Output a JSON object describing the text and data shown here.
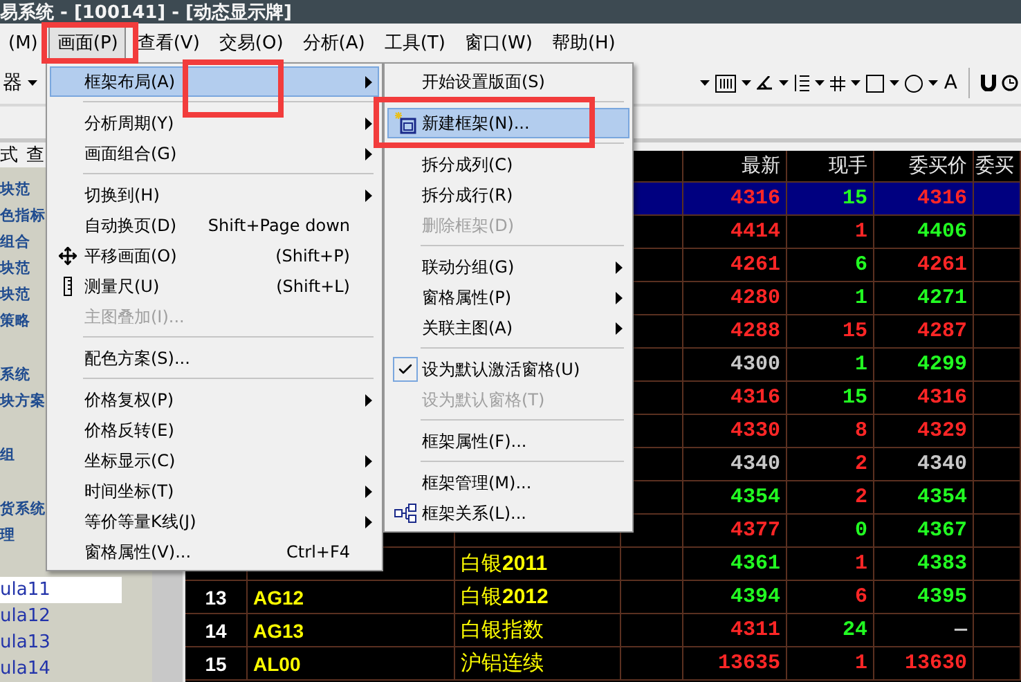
{
  "title_bar": {
    "title": "易系统 - [100141] - [动态显示牌]"
  },
  "menu_bar": [
    {
      "label": "(M)",
      "selected": false
    },
    {
      "label": "画面(P)",
      "selected": true
    },
    {
      "label": "查看(V)",
      "selected": false
    },
    {
      "label": "交易(O)",
      "selected": false
    },
    {
      "label": "分析(A)",
      "selected": false
    },
    {
      "label": "工具(T)",
      "selected": false
    },
    {
      "label": "窗口(W)",
      "selected": false
    },
    {
      "label": "帮助(H)",
      "selected": false
    }
  ],
  "toolbar": {
    "left_label": "器",
    "tools": [
      {
        "kind": "caret"
      },
      {
        "kind": "columns"
      },
      {
        "kind": "caret"
      },
      {
        "kind": "angle"
      },
      {
        "kind": "caret"
      },
      {
        "kind": "list"
      },
      {
        "kind": "caret"
      },
      {
        "kind": "grid"
      },
      {
        "kind": "caret"
      },
      {
        "kind": "square"
      },
      {
        "kind": "caret"
      },
      {
        "kind": "circle"
      },
      {
        "kind": "caret"
      },
      {
        "kind": "text",
        "label": "A"
      },
      {
        "kind": "separator"
      },
      {
        "kind": "magnet"
      },
      {
        "kind": "clock"
      }
    ]
  },
  "sidebar": {
    "tabs": [
      "式",
      "查"
    ],
    "groups": [
      {
        "kind": "category",
        "items": [
          {
            "label": "块范",
            "selected": false
          },
          {
            "label": "色指标",
            "selected": false
          },
          {
            "label": "组合",
            "selected": false
          },
          {
            "label": "块范",
            "selected": false
          },
          {
            "label": "块范",
            "selected": false
          },
          {
            "label": "策略",
            "selected": false
          }
        ]
      },
      {
        "kind": "category",
        "items": [
          {
            "label": "系统",
            "selected": false
          },
          {
            "label": "块方案",
            "selected": false
          }
        ]
      },
      {
        "kind": "category",
        "items": [
          {
            "label": "组",
            "selected": false
          }
        ]
      },
      {
        "kind": "category",
        "items": [
          {
            "label": "货系统",
            "selected": false
          },
          {
            "label": "理",
            "selected": false
          }
        ]
      },
      {
        "kind": "formula",
        "items": [
          {
            "label": "ula11",
            "selected": true
          },
          {
            "label": "ula12",
            "selected": false
          },
          {
            "label": "ula13",
            "selected": false
          },
          {
            "label": "ula14",
            "selected": false
          }
        ]
      }
    ]
  },
  "table": {
    "columns": [
      {
        "label": "最新"
      },
      {
        "label": "现手"
      },
      {
        "label": "委买价"
      },
      {
        "label": "委买"
      }
    ],
    "rows": [
      {
        "selected": true,
        "last": {
          "text": "4316",
          "color": "#ff2626"
        },
        "volume": {
          "text": "15",
          "color": "#22ff22"
        },
        "bid": {
          "text": "4316",
          "color": "#ff2626"
        }
      },
      {
        "selected": false,
        "last": {
          "text": "4414",
          "color": "#ff2626"
        },
        "volume": {
          "text": "1",
          "color": "#ff2626"
        },
        "bid": {
          "text": "4406",
          "color": "#22ff22"
        }
      },
      {
        "selected": false,
        "last": {
          "text": "4261",
          "color": "#ff2626"
        },
        "volume": {
          "text": "6",
          "color": "#22ff22"
        },
        "bid": {
          "text": "4261",
          "color": "#ff2626"
        }
      },
      {
        "selected": false,
        "last": {
          "text": "4280",
          "color": "#ff2626"
        },
        "volume": {
          "text": "1",
          "color": "#22ff22"
        },
        "bid": {
          "text": "4271",
          "color": "#22ff22"
        }
      },
      {
        "selected": false,
        "last": {
          "text": "4288",
          "color": "#ff2626"
        },
        "volume": {
          "text": "15",
          "color": "#ff2626"
        },
        "bid": {
          "text": "4287",
          "color": "#ff2626"
        }
      },
      {
        "selected": false,
        "last": {
          "text": "4300",
          "color": "#c8c8c8"
        },
        "volume": {
          "text": "1",
          "color": "#22ff22"
        },
        "bid": {
          "text": "4299",
          "color": "#22ff22"
        }
      },
      {
        "selected": false,
        "last": {
          "text": "4316",
          "color": "#ff2626"
        },
        "volume": {
          "text": "15",
          "color": "#22ff22"
        },
        "bid": {
          "text": "4316",
          "color": "#ff2626"
        }
      },
      {
        "selected": false,
        "last": {
          "text": "4330",
          "color": "#ff2626"
        },
        "volume": {
          "text": "8",
          "color": "#ff2626"
        },
        "bid": {
          "text": "4329",
          "color": "#ff2626"
        }
      },
      {
        "selected": false,
        "last": {
          "text": "4340",
          "color": "#c8c8c8"
        },
        "volume": {
          "text": "2",
          "color": "#ff2626"
        },
        "bid": {
          "text": "4340",
          "color": "#c8c8c8"
        }
      },
      {
        "selected": false,
        "last": {
          "text": "4354",
          "color": "#22ff22"
        },
        "volume": {
          "text": "2",
          "color": "#ff2626"
        },
        "bid": {
          "text": "4354",
          "color": "#22ff22"
        }
      },
      {
        "selected": false,
        "last": {
          "text": "4377",
          "color": "#ff2626"
        },
        "volume": {
          "text": "0",
          "color": "#22ff22"
        },
        "bid": {
          "text": "4367",
          "color": "#22ff22"
        }
      },
      {
        "selected": false,
        "name": "白银**2011**",
        "last": {
          "text": "4361",
          "color": "#22ff22"
        },
        "volume": {
          "text": "1",
          "color": "#ff2626"
        },
        "bid": {
          "text": "4383",
          "color": "#22ff22"
        }
      },
      {
        "selected": false,
        "number": "13",
        "code": "AG12",
        "name": "白银**2012**",
        "last": {
          "text": "4394",
          "color": "#22ff22"
        },
        "volume": {
          "text": "6",
          "color": "#ff2626"
        },
        "bid": {
          "text": "4395",
          "color": "#22ff22"
        }
      },
      {
        "selected": false,
        "number": "14",
        "code": "AG13",
        "name": "白银指数",
        "last": {
          "text": "4311",
          "color": "#ff2626"
        },
        "volume": {
          "text": "24",
          "color": "#22ff22"
        },
        "bid": {
          "text": "—",
          "color": "#c8c8c8"
        }
      },
      {
        "selected": false,
        "number": "15",
        "code": "AL00",
        "name": "沪铝连续",
        "last": {
          "text": "13635",
          "color": "#ff2626"
        },
        "volume": {
          "text": "1",
          "color": "#ff2626"
        },
        "bid": {
          "text": "13630",
          "color": "#ff2626"
        }
      }
    ]
  },
  "view_menu": {
    "items": [
      {
        "kind": "item",
        "label": "框架布局(A)",
        "selected": true,
        "disabled": false,
        "submenu": true
      },
      {
        "kind": "separator"
      },
      {
        "kind": "item",
        "label": "分析周期(Y)",
        "selected": false,
        "disabled": false,
        "submenu": true
      },
      {
        "kind": "item",
        "label": "画面组合(G)",
        "selected": false,
        "disabled": false,
        "submenu": true
      },
      {
        "kind": "separator"
      },
      {
        "kind": "item",
        "label": "切换到(H)",
        "selected": false,
        "disabled": false,
        "submenu": true
      },
      {
        "kind": "item",
        "label": "自动换页(D)",
        "shortcut": "Shift+Page down",
        "selected": false,
        "disabled": false,
        "submenu": false
      },
      {
        "kind": "item",
        "label": "平移画面(O)",
        "shortcut": "(Shift+P)",
        "selected": false,
        "disabled": false,
        "submenu": false
      },
      {
        "kind": "item",
        "label": "测量尺(U)",
        "shortcut": "(Shift+L)",
        "selected": false,
        "disabled": false,
        "submenu": false
      },
      {
        "kind": "item",
        "label": "主图叠加(I)...",
        "selected": false,
        "disabled": true,
        "submenu": false
      },
      {
        "kind": "separator"
      },
      {
        "kind": "item",
        "label": "配色方案(S)...",
        "selected": false,
        "disabled": false,
        "submenu": false
      },
      {
        "kind": "separator"
      },
      {
        "kind": "item",
        "label": "价格复权(P)",
        "selected": false,
        "disabled": false,
        "submenu": true
      },
      {
        "kind": "item",
        "label": "价格反转(E)",
        "selected": false,
        "disabled": false,
        "submenu": false
      },
      {
        "kind": "item",
        "label": "坐标显示(C)",
        "selected": false,
        "disabled": false,
        "submenu": true
      },
      {
        "kind": "item",
        "label": "时间坐标(T)",
        "selected": false,
        "disabled": false,
        "submenu": true
      },
      {
        "kind": "item",
        "label": "等价等量K线(J)",
        "selected": false,
        "disabled": false,
        "submenu": true
      },
      {
        "kind": "item",
        "label": "窗格属性(V)...",
        "shortcut": "Ctrl+F4",
        "selected": false,
        "disabled": false,
        "submenu": false
      }
    ]
  },
  "layout_submenu": {
    "items": [
      {
        "kind": "item",
        "label": "开始设置版面(S)",
        "selected": false,
        "disabled": false,
        "checked": false,
        "submenu": false
      },
      {
        "kind": "separator"
      },
      {
        "kind": "item",
        "label": "新建框架(N)...",
        "selected": true,
        "disabled": false,
        "checked": false,
        "submenu": false
      },
      {
        "kind": "separator"
      },
      {
        "kind": "item",
        "label": "拆分成列(C)",
        "selected": false,
        "disabled": false,
        "checked": false,
        "submenu": false
      },
      {
        "kind": "item",
        "label": "拆分成行(R)",
        "selected": false,
        "disabled": false,
        "checked": false,
        "submenu": false
      },
      {
        "kind": "item",
        "label": "删除框架(D)",
        "selected": false,
        "disabled": true,
        "checked": false,
        "submenu": false
      },
      {
        "kind": "separator"
      },
      {
        "kind": "item",
        "label": "联动分组(G)",
        "selected": false,
        "disabled": false,
        "checked": false,
        "submenu": true
      },
      {
        "kind": "item",
        "label": "窗格属性(P)",
        "selected": false,
        "disabled": false,
        "checked": false,
        "submenu": true
      },
      {
        "kind": "item",
        "label": "关联主图(A)",
        "selected": false,
        "disabled": false,
        "checked": false,
        "submenu": true
      },
      {
        "kind": "separator"
      },
      {
        "kind": "item",
        "label": "设为默认激活窗格(U)",
        "selected": false,
        "disabled": false,
        "checked": true,
        "submenu": false
      },
      {
        "kind": "item",
        "label": "设为默认窗格(T)",
        "selected": false,
        "disabled": true,
        "checked": false,
        "submenu": false
      },
      {
        "kind": "separator"
      },
      {
        "kind": "item",
        "label": "框架属性(F)...",
        "selected": false,
        "disabled": false,
        "checked": false,
        "submenu": false
      },
      {
        "kind": "separator"
      },
      {
        "kind": "item",
        "label": "框架管理(M)...",
        "selected": false,
        "disabled": false,
        "checked": false,
        "submenu": false
      },
      {
        "kind": "item",
        "label": "框架关系(L)...",
        "selected": false,
        "disabled": false,
        "checked": false,
        "submenu": false
      }
    ]
  },
  "annotations": [
    {
      "kind": "frame"
    },
    {
      "kind": "frame"
    },
    {
      "kind": "frame"
    }
  ]
}
